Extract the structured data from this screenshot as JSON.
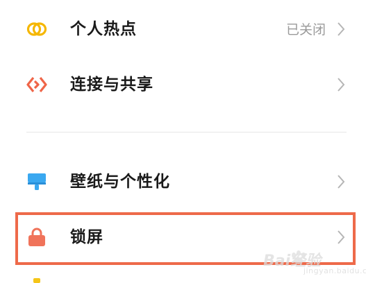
{
  "settings": {
    "items": [
      {
        "label": "个人热点",
        "status": "已关闭",
        "icon": "hotspot-icon"
      },
      {
        "label": "连接与共享",
        "status": "",
        "icon": "connection-share-icon"
      },
      {
        "label": "壁纸与个性化",
        "status": "",
        "icon": "wallpaper-icon"
      },
      {
        "label": "锁屏",
        "status": "",
        "icon": "lock-icon"
      }
    ]
  },
  "highlight": {
    "color": "#ee6a4a",
    "target": "锁屏"
  },
  "colors": {
    "hotspot_icon": "#f5b700",
    "share_icon": "#ef6548",
    "wallpaper_icon": "#3aa8f0",
    "lock_icon": "#f0735a",
    "text": "#1a1a1a",
    "secondary_text": "#9a9a9a"
  },
  "watermark": {
    "brand": "Bai经验",
    "domain": "jingyan.baidu.com"
  }
}
